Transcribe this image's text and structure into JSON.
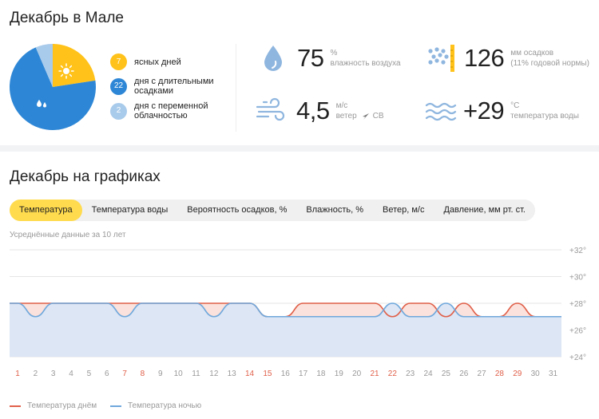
{
  "summary": {
    "title": "Декабрь в Мале",
    "days": [
      {
        "count": "7",
        "label": "ясных дней",
        "color": "#ffc21a",
        "text_color": "#ffffff"
      },
      {
        "count": "22",
        "label": "дня с длительными осадками",
        "color": "#2e87d6",
        "text_color": "#ffffff"
      },
      {
        "count": "2",
        "label": "дня с переменной облачностью",
        "color": "#a9cbeb",
        "text_color": "#ffffff"
      }
    ],
    "pie": [
      {
        "name": "clear",
        "value": 7,
        "color": "#ffc21a"
      },
      {
        "name": "rain",
        "value": 22,
        "color": "#2e87d6"
      },
      {
        "name": "cloudy",
        "value": 2,
        "color": "#a9cbeb"
      }
    ],
    "humidity": {
      "value": "75",
      "unit": "%",
      "label": "влажность воздуха",
      "icon": "drop-icon"
    },
    "precip": {
      "value": "126",
      "unit": "мм осадков",
      "note": "(11% годовой нормы)",
      "icon": "rain-gauge-icon"
    },
    "wind": {
      "value": "4,5",
      "unit": "м/с",
      "label": "ветер",
      "direction": "СВ",
      "icon": "wind-icon"
    },
    "water": {
      "value": "+29",
      "unit": "°С",
      "label": "температура воды",
      "icon": "waves-icon"
    }
  },
  "charts": {
    "title": "Декабрь на графиках",
    "tabs": [
      "Температура",
      "Температура воды",
      "Вероятность осадков, %",
      "Влажность, %",
      "Ветер, м/с",
      "Давление, мм рт. ст."
    ],
    "active_tab": 0,
    "note": "Усреднённые данные за 10 лет",
    "legend_day": "Температура днём",
    "legend_night": "Температура ночью",
    "day_color": "#e0604a",
    "night_color": "#6fa8dc"
  },
  "chart_data": {
    "type": "line",
    "x": [
      1,
      2,
      3,
      4,
      5,
      6,
      7,
      8,
      9,
      10,
      11,
      12,
      13,
      14,
      15,
      16,
      17,
      18,
      19,
      20,
      21,
      22,
      23,
      24,
      25,
      26,
      27,
      28,
      29,
      30,
      31
    ],
    "weekend_days": [
      1,
      7,
      8,
      14,
      15,
      21,
      22,
      28,
      29
    ],
    "weekend_color": "#e0604a",
    "y_ticks": [
      "+24°",
      "+26°",
      "+28°",
      "+30°",
      "+32°"
    ],
    "ylim": [
      24,
      32
    ],
    "series": [
      {
        "name": "Температура днём",
        "values": [
          28,
          28,
          28,
          28,
          28,
          28,
          28,
          28,
          28,
          28,
          28,
          28,
          28,
          28,
          27,
          27,
          28,
          28,
          28,
          28,
          28,
          27,
          28,
          28,
          27,
          28,
          27,
          27,
          28,
          27,
          27
        ]
      },
      {
        "name": "Температура ночью",
        "values": [
          28,
          27,
          28,
          28,
          28,
          28,
          27,
          28,
          28,
          28,
          28,
          27,
          28,
          28,
          27,
          27,
          27,
          27,
          27,
          27,
          27,
          28,
          27,
          27,
          28,
          27,
          27,
          27,
          27,
          27,
          27
        ]
      }
    ]
  }
}
